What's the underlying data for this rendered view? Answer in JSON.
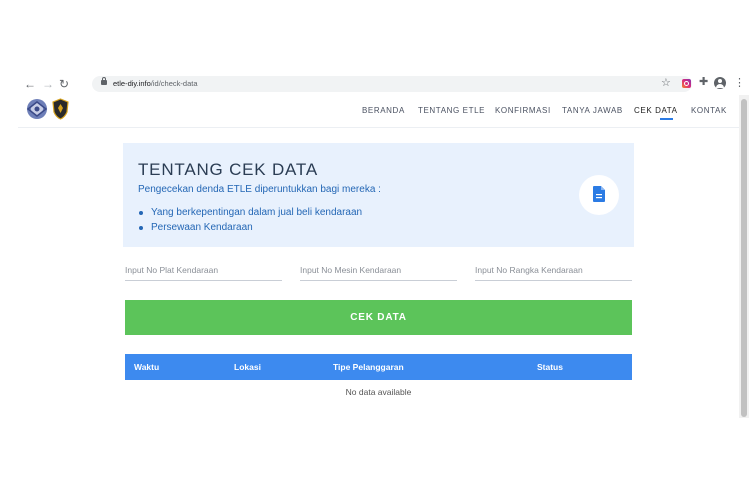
{
  "browser": {
    "url_host": "etle-diy.info",
    "url_path": "/id/check-data"
  },
  "header": {
    "menu": [
      {
        "label": "BERANDA"
      },
      {
        "label": "TENTANG ETLE"
      },
      {
        "label": "KONFIRMASI"
      },
      {
        "label": "TANYA JAWAB"
      },
      {
        "label": "CEK DATA",
        "active": true
      },
      {
        "label": "KONTAK"
      }
    ]
  },
  "info": {
    "title": "TENTANG CEK DATA",
    "subtitle": "Pengecekan denda ETLE diperuntukkan bagi mereka :",
    "items": [
      "Yang berkepentingan dalam jual beli kendaraan",
      "Persewaan Kendaraan"
    ],
    "icon": "document-icon"
  },
  "form": {
    "plat_placeholder": "Input No Plat Kendaraan",
    "mesin_placeholder": "Input No Mesin Kendaraan",
    "rangka_placeholder": "Input No Rangka Kendaraan",
    "button_label": "CEK DATA"
  },
  "table": {
    "columns": [
      "Waktu",
      "Lokasi",
      "Tipe Pelanggaran",
      "Status"
    ],
    "empty_text": "No data available"
  },
  "colors": {
    "accent_blue": "#3d8aef",
    "button_green": "#5cc45a",
    "card_bg": "#e8f1fd"
  }
}
